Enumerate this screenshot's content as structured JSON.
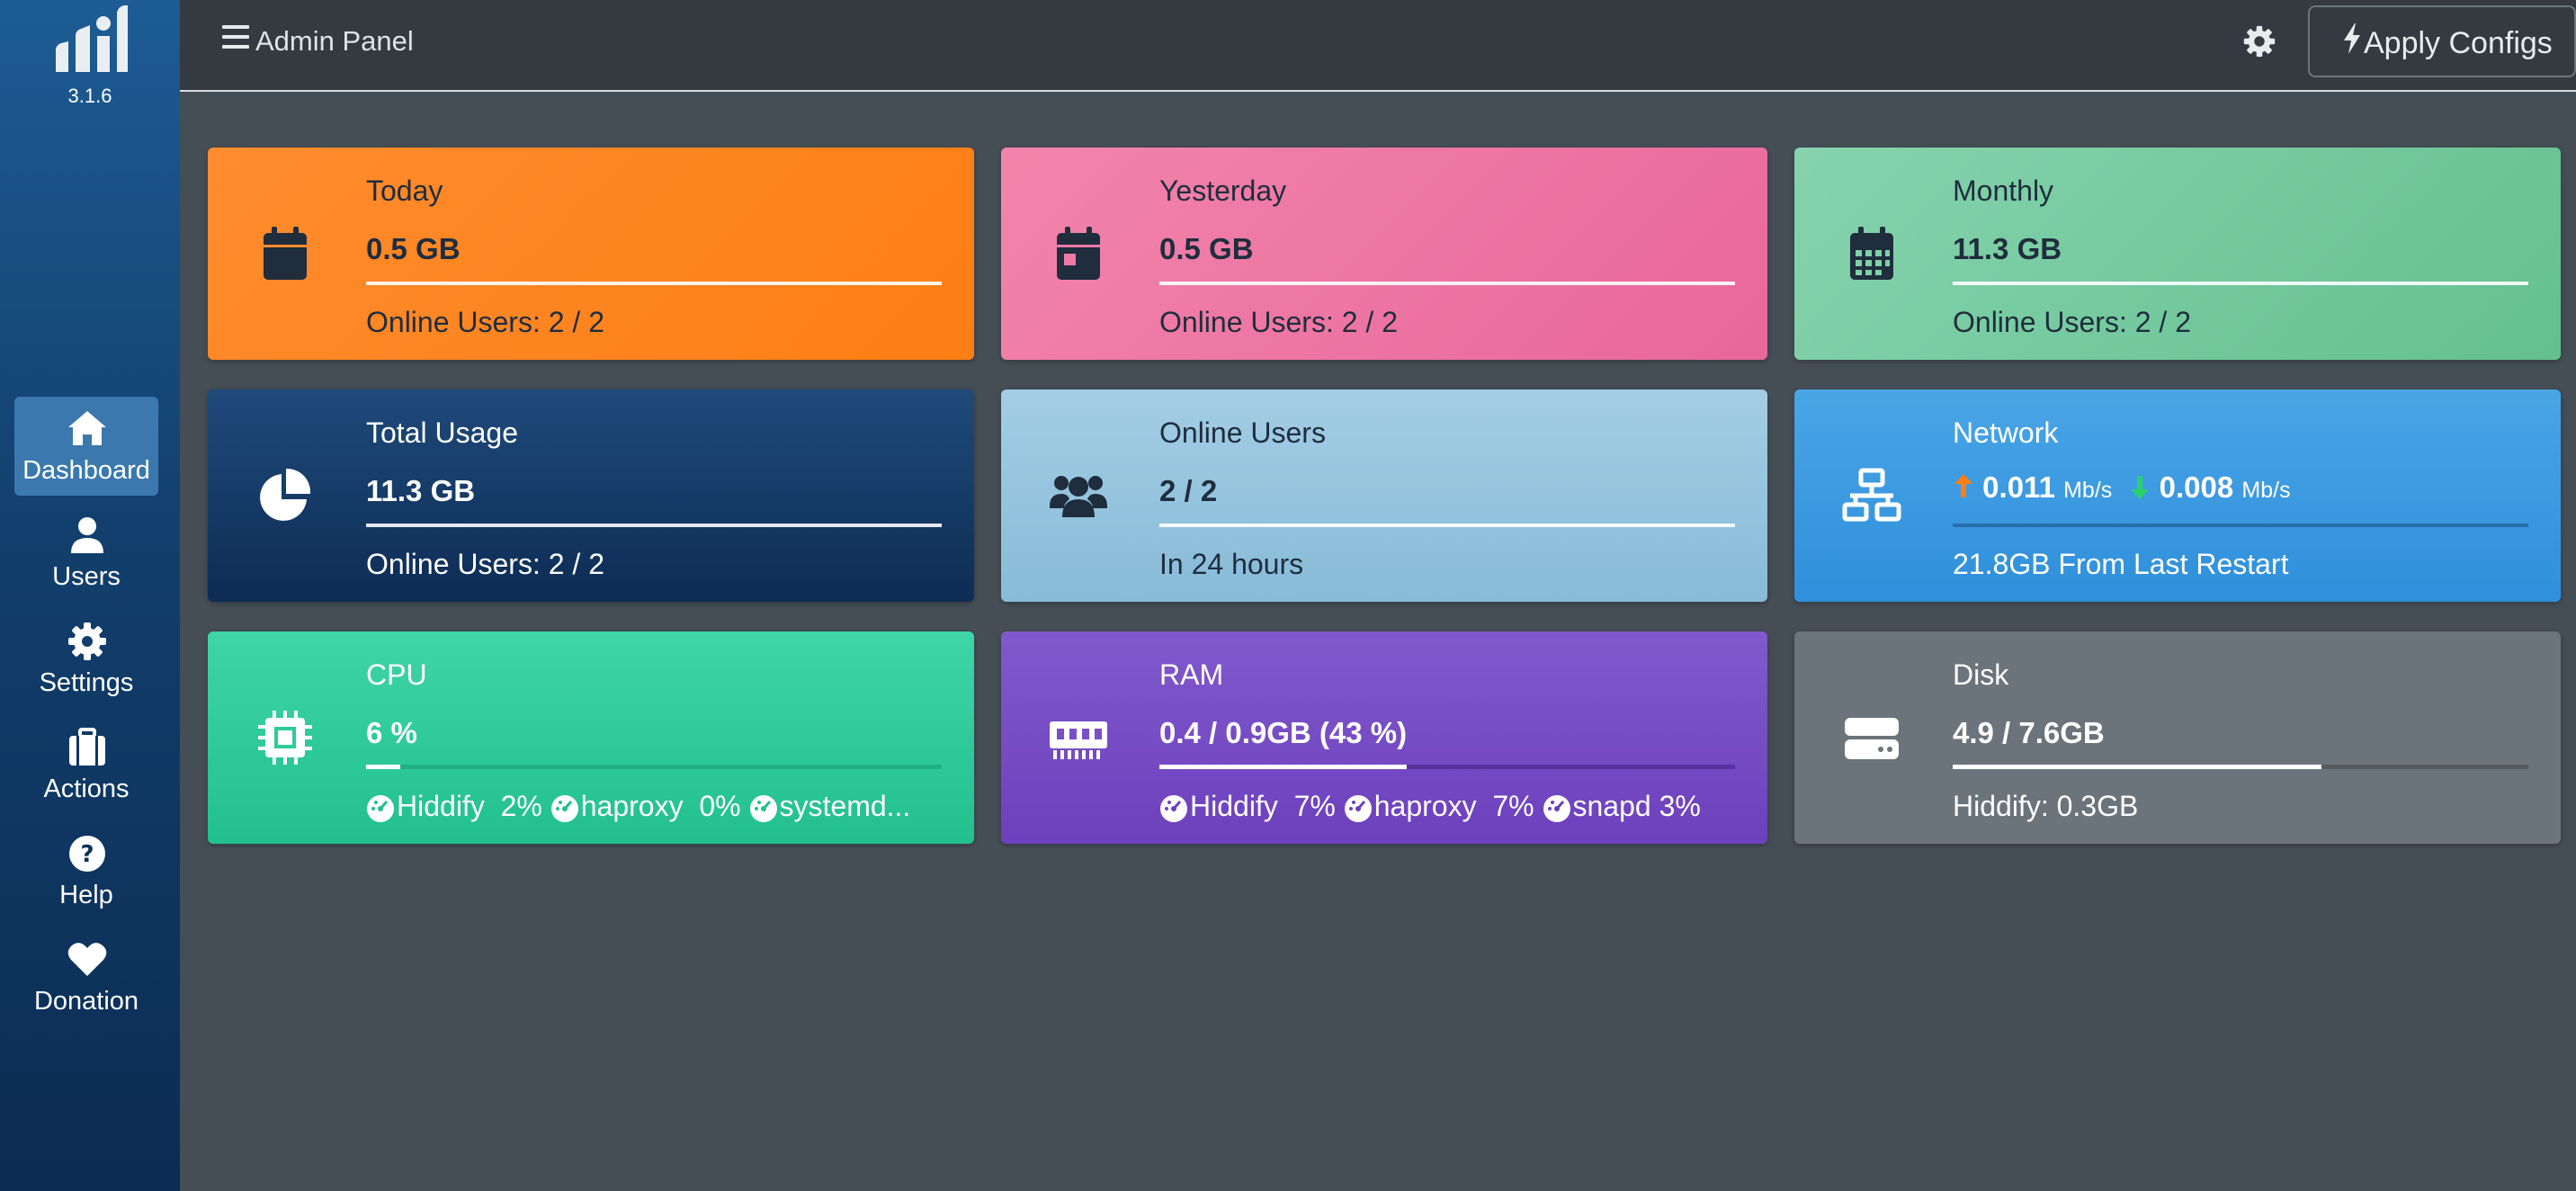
{
  "sidebar": {
    "version": "3.1.6",
    "items": [
      {
        "label": "Dashboard",
        "icon": "home-icon",
        "active": true
      },
      {
        "label": "Users",
        "icon": "user-icon"
      },
      {
        "label": "Settings",
        "icon": "gear-icon"
      },
      {
        "label": "Actions",
        "icon": "briefcase-icon"
      },
      {
        "label": "Help",
        "icon": "question-circle-icon"
      },
      {
        "label": "Donation",
        "icon": "heart-icon"
      }
    ]
  },
  "header": {
    "title": "Admin Panel",
    "apply_label": "Apply Configs"
  },
  "cards": {
    "today": {
      "label": "Today",
      "value": "0.5 GB",
      "sub": "Online Users: 2 / 2",
      "color": "#fd7e14"
    },
    "yesterday": {
      "label": "Yesterday",
      "value": "0.5 GB",
      "sub": "Online Users: 2 / 2",
      "color": "#e8679a"
    },
    "monthly": {
      "label": "Monthly",
      "value": "11.3 GB",
      "sub": "Online Users: 2 / 2",
      "color": "#64c08f"
    },
    "total": {
      "label": "Total Usage",
      "value": "11.3 GB",
      "sub": "Online Users: 2 / 2",
      "color": "#0d2c55"
    },
    "online": {
      "label": "Online Users",
      "value": "2 / 2",
      "sub": "In 24 hours",
      "color": "#87bbd8"
    },
    "network": {
      "label": "Network",
      "up_value": "0.011",
      "up_unit": "Mb/s",
      "down_value": "0.008",
      "down_unit": "Mb/s",
      "sub": "21.8GB From Last Restart",
      "color": "#2f8fdb"
    },
    "cpu": {
      "label": "CPU",
      "value": "6 %",
      "percent": 6,
      "processes": [
        {
          "name": "Hiddify",
          "usage": "2%"
        },
        {
          "name": "haproxy",
          "usage": "0%"
        },
        {
          "name": "systemd...",
          "usage": ""
        }
      ],
      "color": "#22c08e"
    },
    "ram": {
      "label": "RAM",
      "value": "0.4 / 0.9GB (43 %)",
      "percent": 43,
      "processes": [
        {
          "name": "Hiddify",
          "usage": "7%"
        },
        {
          "name": "haproxy",
          "usage": "7%"
        },
        {
          "name": "snapd",
          "usage": "3%"
        }
      ],
      "color": "#6d40bd"
    },
    "disk": {
      "label": "Disk",
      "value": "4.9 / 7.6GB",
      "percent": 64,
      "sub": "Hiddify: 0.3GB",
      "color": "#6b737b"
    }
  }
}
